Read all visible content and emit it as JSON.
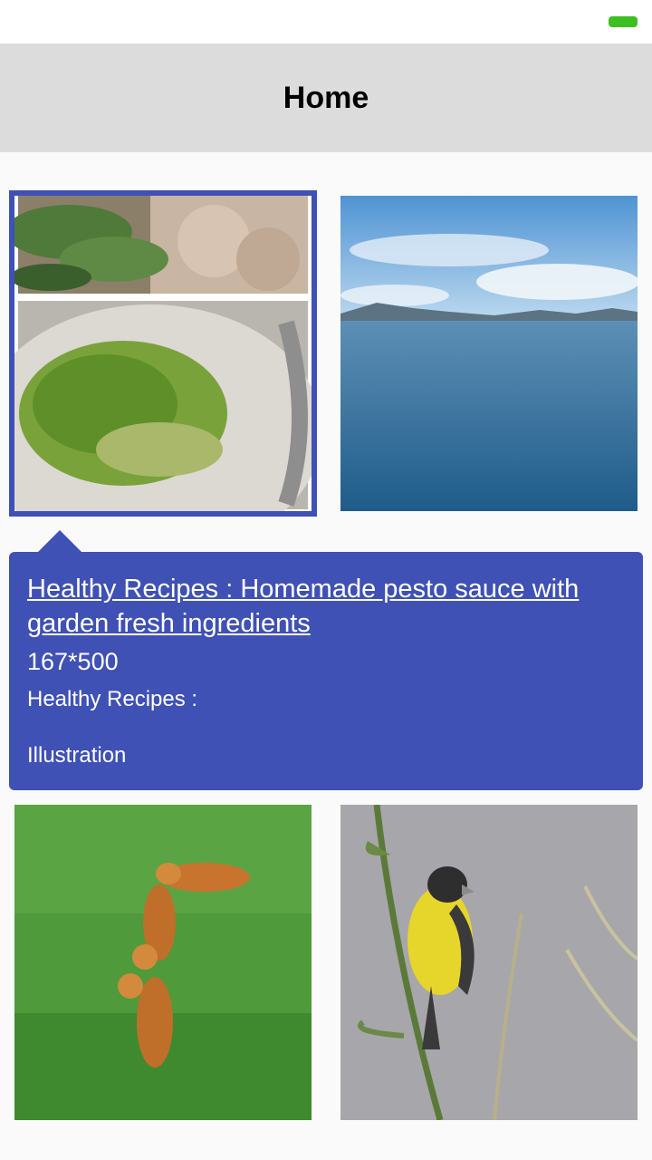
{
  "status_bar": {
    "battery_color": "#3fbf1f"
  },
  "app_bar": {
    "title": "Home"
  },
  "gallery": {
    "items": [
      {
        "image": "pesto-sauce-collage",
        "selected": true
      },
      {
        "image": "sea-landscape",
        "selected": false
      },
      {
        "image": "tigers-on-grass",
        "selected": false
      },
      {
        "image": "yellow-bird-on-stem",
        "selected": false
      }
    ]
  },
  "popup": {
    "title": "Healthy Recipes : Homemade pesto sauce with garden fresh ingredients",
    "size": "167*500",
    "subtitle": "Healthy Recipes :",
    "category": "Illustration",
    "accent": "#3f51b5"
  }
}
